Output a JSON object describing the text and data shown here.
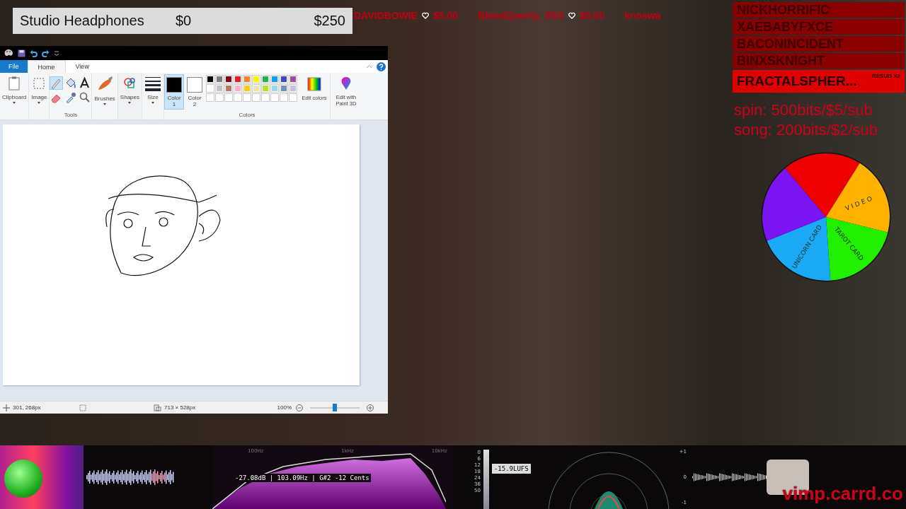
{
  "goal": {
    "title": "Studio Headphones",
    "current": "$0",
    "target": "$250"
  },
  "ticker": [
    {
      "name": "DAVIDBOWIE",
      "amount": "$5.00"
    },
    {
      "name": "BloodQwerty_R5X",
      "amount": "$5.00"
    },
    {
      "name": "knoswa"
    }
  ],
  "paint": {
    "tabs": [
      {
        "label": "File",
        "kind": "file",
        "selected": false
      },
      {
        "label": "Home",
        "kind": "tab",
        "selected": true
      },
      {
        "label": "View",
        "kind": "tab",
        "selected": false
      }
    ],
    "ribbon": {
      "clipboard": "Clipboard",
      "image": "Image",
      "tools_label": "Tools",
      "tools": [
        {
          "kind": "pencil",
          "selected": true
        },
        {
          "kind": "fill",
          "selected": false
        },
        {
          "kind": "text",
          "selected": false
        },
        {
          "kind": "eraser",
          "selected": false
        },
        {
          "kind": "picker",
          "selected": false
        },
        {
          "kind": "magnifier",
          "selected": false
        }
      ],
      "brushes": "Brushes",
      "shapes": "Shapes",
      "size": "Size",
      "color1": {
        "label": "Color 1",
        "color": "#000000",
        "selected": true
      },
      "color2": {
        "label": "Color 2",
        "color": "#ffffff",
        "selected": false
      },
      "palette": [
        {
          "color": "#000000"
        },
        {
          "color": "#7f7f7f"
        },
        {
          "color": "#880015"
        },
        {
          "color": "#ed1c24"
        },
        {
          "color": "#ff7f27"
        },
        {
          "color": "#fff200"
        },
        {
          "color": "#22b14c"
        },
        {
          "color": "#00a2e8"
        },
        {
          "color": "#3f48cc"
        },
        {
          "color": "#a349a4"
        },
        {
          "color": "#ffffff"
        },
        {
          "color": "#c3c3c3"
        },
        {
          "color": "#b97a57"
        },
        {
          "color": "#ffaec9"
        },
        {
          "color": "#ffc90e"
        },
        {
          "color": "#efe4b0"
        },
        {
          "color": "#b5e61d"
        },
        {
          "color": "#99d9ea"
        },
        {
          "color": "#7092be"
        },
        {
          "color": "#c8bfe7"
        }
      ],
      "colors_label": "Colors",
      "edit_colors": "Edit colors",
      "paint3d": "Edit with Paint 3D"
    },
    "status": {
      "position": "301, 268px",
      "canvas_size": "713 × 528px",
      "zoom": "100%",
      "zoom_level": {
        "level": 0.5
      }
    }
  },
  "events": [
    {
      "name": "NICKHORRIFIC",
      "highlighted": false
    },
    {
      "name": "XAEBABYFXCE",
      "highlighted": false
    },
    {
      "name": "BACONINCIDENT",
      "highlighted": false
    },
    {
      "name": "BINXSKNIGHT",
      "highlighted": false
    },
    {
      "name": "FRACTALSPHER...",
      "tag": "RESUB X2",
      "highlighted": true
    }
  ],
  "rules": [
    "spin: 500bits/$5/sub",
    "song: 200bits/$2/sub"
  ],
  "wheel": [
    {
      "color": "#ee0000"
    },
    {
      "label": "V I D E O",
      "color": "#ffb300"
    },
    {
      "label": "TAROT CARD",
      "color": "#22ee00"
    },
    {
      "label": "UNICORN CARD",
      "color": "#1aaaf5"
    },
    {
      "color": "#7a14f0"
    }
  ],
  "audio": {
    "readout": "-27.08dB | 103.09Hz | G#2 -12 Cents",
    "freq_labels": [
      "100Hz",
      "1kHz",
      "10kHz"
    ],
    "meter_scale": [
      "0",
      "6",
      "12",
      "18",
      "24",
      "36",
      "50"
    ],
    "loudness": "-15.9LUFS",
    "scope_scale": [
      "+1",
      "0",
      "-1"
    ]
  },
  "site": "vimp.carrd.co"
}
